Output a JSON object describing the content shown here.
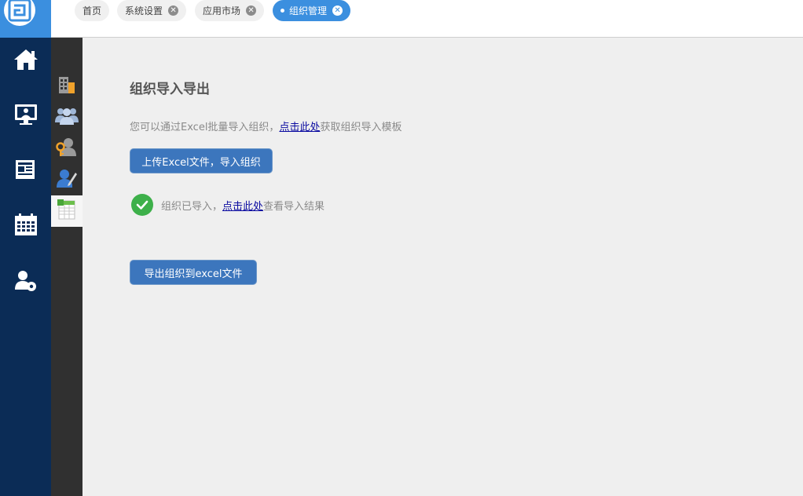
{
  "tabs": [
    {
      "label": "首页",
      "closable": false,
      "active": false
    },
    {
      "label": "系统设置",
      "closable": true,
      "active": false
    },
    {
      "label": "应用市场",
      "closable": true,
      "active": false
    },
    {
      "label": "组织管理",
      "closable": true,
      "active": true
    }
  ],
  "close_glyph": "✕",
  "left_nav": [
    "home-icon",
    "monitor-user-icon",
    "news-icon",
    "calendar-icon",
    "user-settings-icon"
  ],
  "sub_nav": [
    "building-icon",
    "users-group-icon",
    "user-key-icon",
    "user-edit-icon",
    "spreadsheet-icon"
  ],
  "main": {
    "title": "组织导入导出",
    "desc_prefix": "您可以通过Excel批量导入组织，",
    "desc_link": "点击此处",
    "desc_suffix": "获取组织导入模板",
    "upload_button": "上传Excel文件，导入组织",
    "status_prefix": "组织已导入，",
    "status_link": "点击此处",
    "status_suffix": "查看导入结果",
    "export_button": "导出组织到excel文件"
  },
  "colors": {
    "nav_bg": "#0b2c56",
    "accent": "#3b8fdf",
    "button": "#3c76bd",
    "success": "#3db04a",
    "subnav_bg": "#303030"
  }
}
